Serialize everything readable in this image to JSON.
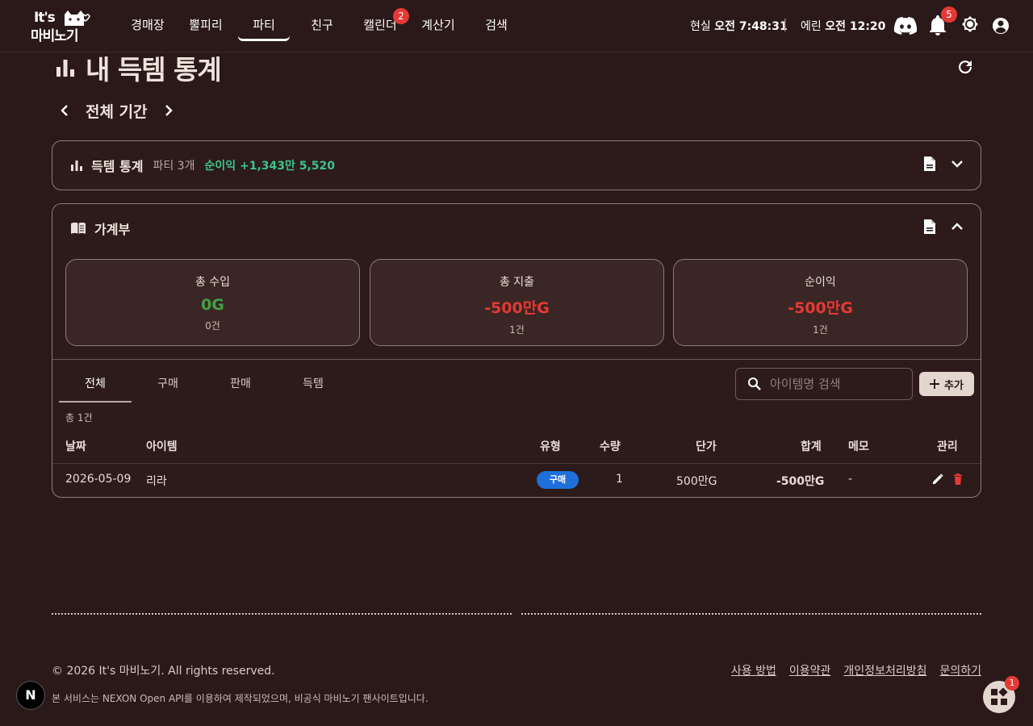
{
  "header": {
    "logo_line1": "It's",
    "logo_line2": "마비노기",
    "nav": [
      {
        "label": "경매장",
        "active": false
      },
      {
        "label": "뿔피리",
        "active": false
      },
      {
        "label": "파티",
        "active": true
      },
      {
        "label": "친구",
        "active": false
      },
      {
        "label": "캘린더",
        "active": false,
        "badge": "2"
      },
      {
        "label": "계산기",
        "active": false
      },
      {
        "label": "검색",
        "active": false
      }
    ],
    "real_time_label": "현실",
    "real_time_value": "오전 7:48:31",
    "separator": "|",
    "erinn_time_label": "에린",
    "erinn_time_value": "오전 12:20",
    "notification_count": "5"
  },
  "page": {
    "title": "내 득템 통계",
    "period_label": "전체 기간"
  },
  "stats_card": {
    "title": "득템 통계",
    "party_count": "파티 3개",
    "net_profit": "순이익 +1,343만 5,520"
  },
  "ledger": {
    "title": "가계부",
    "summary": [
      {
        "label": "총 수입",
        "value": "0G",
        "count": "0건",
        "color": "#43a047"
      },
      {
        "label": "총 지출",
        "value": "-500만G",
        "count": "1건",
        "color": "#e53935"
      },
      {
        "label": "순이익",
        "value": "-500만G",
        "count": "1건",
        "color": "#e53935"
      }
    ],
    "tabs": [
      "전체",
      "구매",
      "판매",
      "득템"
    ],
    "active_tab": "전체",
    "search_placeholder": "아이템명 검색",
    "add_label": "추가",
    "total_count": "총 1건",
    "columns": [
      "날짜",
      "아이템",
      "유형",
      "수량",
      "단가",
      "합계",
      "메모",
      "관리"
    ],
    "rows": [
      {
        "date": "2026-05-09",
        "item": "리라",
        "type": "구매",
        "quantity": "1",
        "unit_price": "500만G",
        "total": "-500만G",
        "memo": "-"
      }
    ]
  },
  "footer": {
    "copyright": "© 2026 It's 마비노기. All rights reserved.",
    "links": [
      "사용 방법",
      "이용약관",
      "개인정보처리방침",
      "문의하기"
    ],
    "notice": "본 서비스는 NEXON Open API를 이용하여 제작되었으며, 비공식 마비노기 팬사이트입니다.",
    "next_badge": "N",
    "fab_badge": "1"
  },
  "colors": {
    "background": "#2a1918",
    "positive": "#3cc48a",
    "income": "#43a047",
    "expense": "#e53935",
    "purchase_chip": "#1e6fd9"
  }
}
